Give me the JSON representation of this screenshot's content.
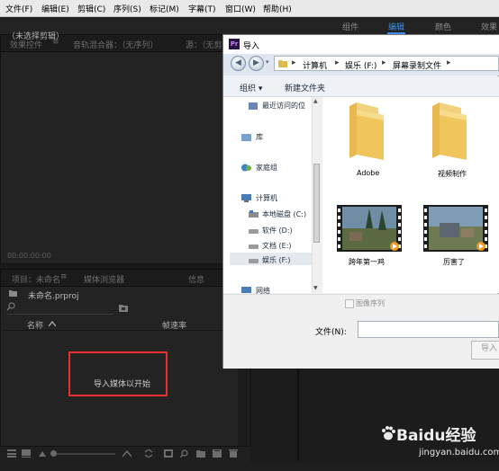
{
  "menu": [
    "文件(F)",
    "编辑(E)",
    "剪辑(C)",
    "序列(S)",
    "标记(M)",
    "字幕(T)",
    "窗口(W)",
    "帮助(H)"
  ],
  "workspaces": [
    "组件",
    "编辑",
    "颜色",
    "效果"
  ],
  "workspace_active": "编辑",
  "source_panel": {
    "tabs": [
      "效果控件",
      "音轨混合器：（无序列）",
      "源：（无剪辑）"
    ],
    "empty_text": "（未选择剪辑）",
    "timecode": "00:00:00:00"
  },
  "project_panel": {
    "tabs": [
      "项目：未命名",
      "媒体浏览器",
      "信息"
    ],
    "filename": "未命名.prproj",
    "columns": {
      "name": "名称",
      "framerate": "帧速率"
    },
    "empty_text": "导入媒体以开始"
  },
  "dialog": {
    "app_icon": "Pr",
    "title": "导入",
    "breadcrumb": [
      "计算机",
      "娱乐 (F:)",
      "屏幕录制文件"
    ],
    "toolbar": {
      "organize": "组织",
      "new_folder": "新建文件夹"
    },
    "nav_items": {
      "recent": "最近访问的位",
      "library": "库",
      "homegroup": "家庭组",
      "computer": "计算机",
      "drive_c": "本地磁盘 (C:)",
      "drive_d": "软件 (D:)",
      "drive_e": "文档 (E:)",
      "drive_f": "娱乐 (F:)",
      "network": "网络"
    },
    "files": [
      {
        "name": "Adobe",
        "type": "folder"
      },
      {
        "name": "视频制作",
        "type": "folder"
      },
      {
        "name": "跨年第一鸡",
        "type": "video"
      },
      {
        "name": "厉害了",
        "type": "video"
      }
    ],
    "image_sequence_label": "图像序列",
    "filename_label": "文件(N):",
    "filename_value": "",
    "import_button": "导入"
  },
  "watermark": {
    "brand": "Baidu经验",
    "url": "jingyan.baidu.com"
  },
  "colors": {
    "accent": "#3b8fe8",
    "highlight_box": "#e5302d"
  }
}
